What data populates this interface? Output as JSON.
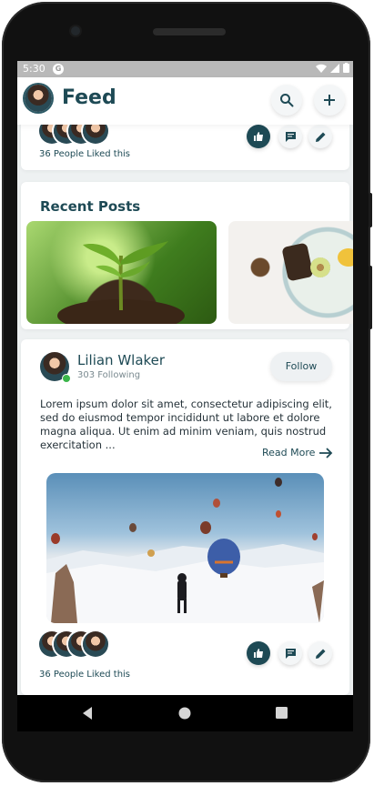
{
  "status_bar": {
    "time": "5:30"
  },
  "header": {
    "title": "Feed"
  },
  "previous_post": {
    "likes_text": "36 People Liked this"
  },
  "recent_posts": {
    "title": "Recent Posts"
  },
  "post": {
    "author": "Lilian Wlaker",
    "following": "303 Following",
    "follow_label": "Follow",
    "body": "Lorem ipsum dolor sit amet, consectetur adipiscing elit, sed do eiusmod tempor incididunt ut labore et dolore magna aliqua. Ut enim ad minim veniam, quis nostrud exercitation ...",
    "read_more": "Read More",
    "likes_text": "36 People Liked this"
  },
  "icons": [
    "search-icon",
    "plus-icon",
    "thumbs-up-icon",
    "comment-icon",
    "edit-icon",
    "arrow-right-icon",
    "back-icon",
    "home-icon",
    "recents-icon"
  ],
  "colors": {
    "primary": "#1e4a55",
    "background": "#eef1f2",
    "online": "#3bb54a"
  }
}
